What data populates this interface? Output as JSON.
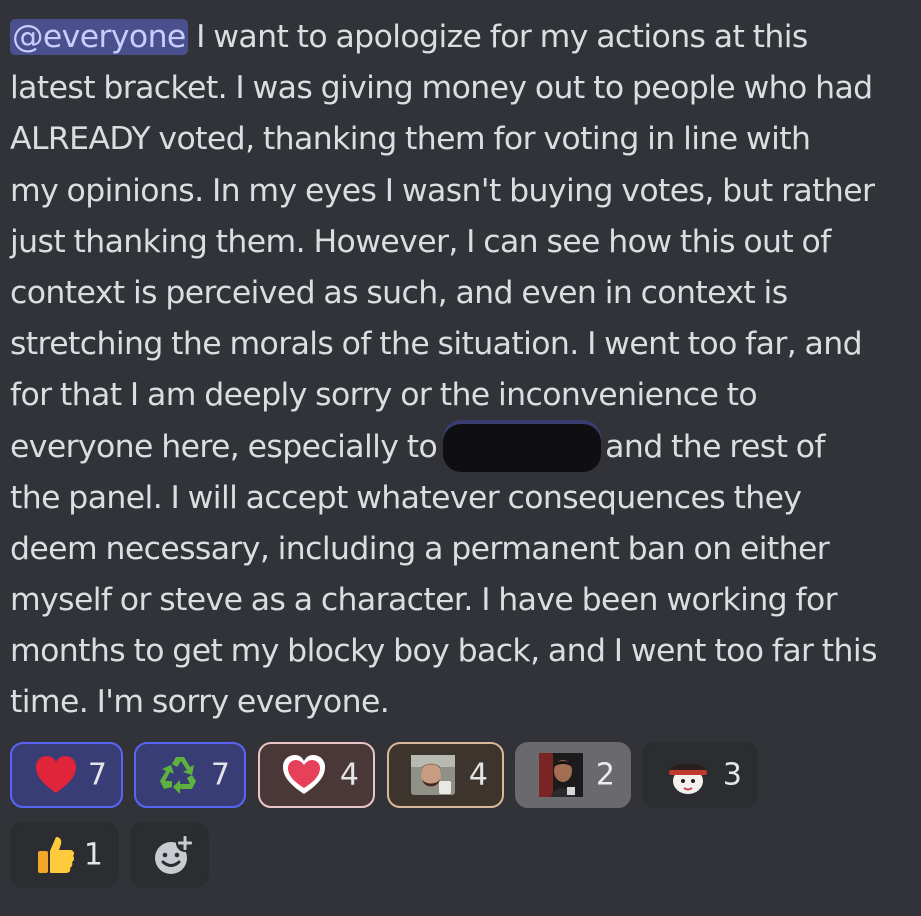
{
  "message": {
    "mention": "@everyone",
    "line1_rest": " I want to apologize for my actions at this",
    "line2": "latest bracket. I was giving money out to people who had",
    "line3": "ALREADY voted, thanking them for voting in line with",
    "line4": "my opinions. In my eyes I wasn't buying votes, but rather",
    "line5": "just thanking them. However, I can see how this out of",
    "line6": "context is perceived as such, and even in context is",
    "line7": "stretching the morals of the situation. I went too far, and",
    "line8": "for that I am deeply sorry or the inconvenience to",
    "line9_before": "everyone here, especially to",
    "line9_after": "and the rest of",
    "line10": "the panel. I will accept whatever consequences they",
    "line11": "deem necessary, including a permanent ban on either",
    "line12": "myself or steve as a character. I have been working for",
    "line13": "months to get my blocky boy back, and I went too far this",
    "line14": "time. I'm sorry everyone."
  },
  "reactions": [
    {
      "emoji": "red-heart",
      "count": "7"
    },
    {
      "emoji": "recycle",
      "count": "7"
    },
    {
      "emoji": "heart-white-outline",
      "count": "4"
    },
    {
      "emoji": "custom-face-photo",
      "count": "4"
    },
    {
      "emoji": "custom-portrait-photo",
      "count": "2"
    },
    {
      "emoji": "custom-hat-face",
      "count": "3"
    },
    {
      "emoji": "thumbs-up",
      "count": "1"
    }
  ],
  "add_reaction": {
    "icon": "add-reaction-icon"
  },
  "colors": {
    "background": "#313338",
    "mention_bg": "#4a4f8e",
    "active_border": "#5865f2",
    "text": "#dbdee1"
  }
}
